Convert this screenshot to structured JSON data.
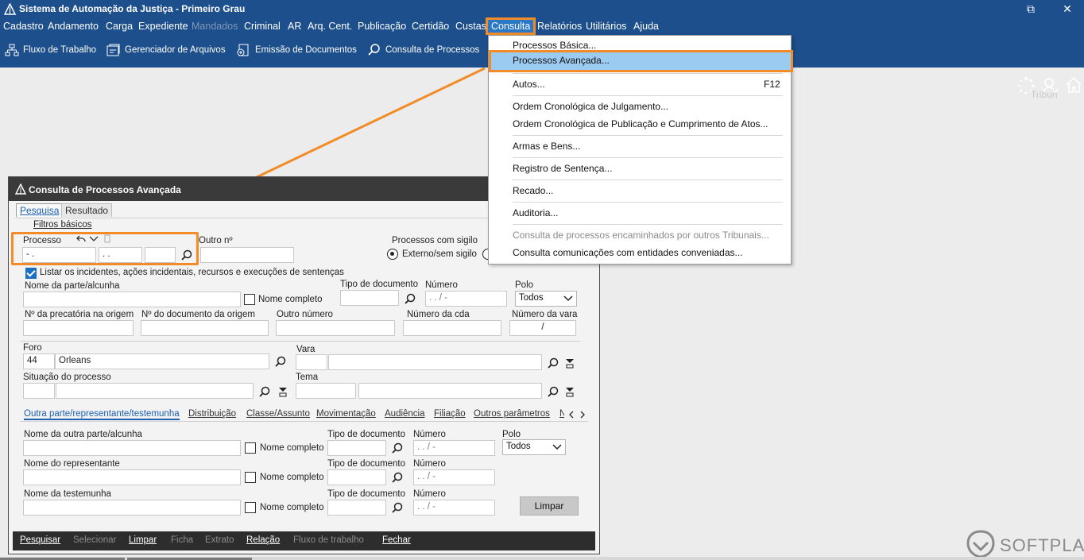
{
  "window": {
    "title": "Sistema de Automação da Justiça - Primeiro Grau",
    "restore_glyph": "⧉",
    "close_glyph": "✕"
  },
  "menu": {
    "items": [
      {
        "label": "Cadastro",
        "state": "normal"
      },
      {
        "label": "Andamento",
        "state": "normal"
      },
      {
        "label": "Carga",
        "state": "normal"
      },
      {
        "label": "Expediente",
        "state": "normal"
      },
      {
        "label": "Mandados",
        "state": "disabled"
      },
      {
        "label": "Criminal",
        "state": "normal"
      },
      {
        "label": "AR",
        "state": "normal"
      },
      {
        "label": "Arq. Cent.",
        "state": "normal"
      },
      {
        "label": "Publicação",
        "state": "normal"
      },
      {
        "label": "Certidão",
        "state": "normal"
      },
      {
        "label": "Custas",
        "state": "normal"
      },
      {
        "label": "Consulta",
        "state": "active"
      },
      {
        "label": "Relatórios",
        "state": "normal"
      },
      {
        "label": "Utilitários",
        "state": "normal"
      },
      {
        "label": "Ajuda",
        "state": "normal"
      }
    ]
  },
  "toolbar": {
    "items": [
      {
        "label": "Fluxo de Trabalho",
        "icon": "workflow-icon"
      },
      {
        "label": "Gerenciador de Arquivos",
        "icon": "file-manager-icon"
      },
      {
        "label": "Emissão de Documentos",
        "icon": "document-add-icon"
      },
      {
        "label": "Consulta de Processos",
        "icon": "search-icon"
      }
    ]
  },
  "background_watermark": "Tribun",
  "dropdown": {
    "items": [
      {
        "label": "Processos Básica...",
        "shortcut": "",
        "state": "normal"
      },
      {
        "label": "Processos Avançada...",
        "shortcut": "",
        "state": "highlighted"
      },
      {
        "label": "Autos...",
        "shortcut": "F12",
        "state": "normal"
      },
      {
        "label": "Ordem Cronológica de Julgamento...",
        "shortcut": "",
        "state": "normal"
      },
      {
        "label": "Ordem Cronológica de Publicação e Cumprimento de Atos...",
        "shortcut": "",
        "state": "normal"
      },
      {
        "label": "Armas e Bens...",
        "shortcut": "",
        "state": "normal"
      },
      {
        "label": "Registro de Sentença...",
        "shortcut": "",
        "state": "normal"
      },
      {
        "label": "Recado...",
        "shortcut": "",
        "state": "normal"
      },
      {
        "label": "Auditoria...",
        "shortcut": "",
        "state": "normal"
      },
      {
        "label": "Consulta de processos encaminhados por outros Tribunais...",
        "shortcut": "",
        "state": "disabled"
      },
      {
        "label": "Consulta comunicações com entidades conveniadas...",
        "shortcut": "",
        "state": "normal"
      }
    ]
  },
  "dialog": {
    "title": "Consulta de Processos Avançada",
    "tabs": [
      {
        "label": "Pesquisa",
        "selected": true
      },
      {
        "label": "Resultado",
        "selected": false
      }
    ],
    "filtros_label": "Filtros básicos",
    "processo": {
      "label": "Processo",
      "value1": "- .",
      "value2": ". .",
      "value3": ""
    },
    "outro_n_label": "Outro nº",
    "sigilo": {
      "label": "Processos com sigilo",
      "option": "Externo/sem sigilo"
    },
    "listar_checkbox": {
      "label": "Listar os incidentes, ações incidentais, recursos e execuções de sentenças",
      "checked": true
    },
    "nome_parte_label": "Nome da parte/alcunha",
    "nome_completo_label": "Nome completo",
    "tipo_documento_label": "Tipo de documento",
    "numero_label": "Número",
    "numero_value": ". . /   -",
    "polo_label": "Polo",
    "polo_value": "Todos",
    "precatoria_label": "Nº da precatória na origem",
    "doc_origem_label": "Nº do documento da origem",
    "outro_numero_label": "Outro número",
    "numero_cda_label": "Número da cda",
    "numero_vara_label": "Número da vara",
    "numero_vara_value": "/",
    "foro_label": "Foro",
    "foro_code": "44",
    "foro_name": "Orleans",
    "vara_label": "Vara",
    "situacao_label": "Situação do processo",
    "tema_label": "Tema",
    "subtabs": [
      {
        "label": "Outra parte/representante/testemunha",
        "selected": true
      },
      {
        "label": "Distribuição",
        "selected": false
      },
      {
        "label": "Classe/Assunto",
        "selected": false
      },
      {
        "label": "Movimentação",
        "selected": false
      },
      {
        "label": "Audiência",
        "selected": false
      },
      {
        "label": "Filiação",
        "selected": false
      },
      {
        "label": "Outros parâmetros",
        "selected": false
      },
      {
        "label": "N",
        "selected": false
      }
    ],
    "outra_parte_label": "Nome da outra parte/alcunha",
    "representante_label": "Nome do representante",
    "testemunha_label": "Nome da testemunha",
    "limpar_button": "Limpar",
    "actions": [
      {
        "label": "Pesquisar",
        "enabled": true
      },
      {
        "label": "Selecionar",
        "enabled": false
      },
      {
        "label": "Limpar",
        "enabled": true
      },
      {
        "label": "Ficha",
        "enabled": false
      },
      {
        "label": "Extrato",
        "enabled": false
      },
      {
        "label": "Relação",
        "enabled": true
      },
      {
        "label": "Fluxo de trabalho",
        "enabled": false
      },
      {
        "label": "Fechar",
        "enabled": true
      }
    ]
  },
  "brand": {
    "logo_text": "SOFTPLAN"
  },
  "colors": {
    "titlebar": "#1c4f8c",
    "highlight": "#f28c28",
    "menu_selected": "#9ccbf2",
    "dialog_title": "#3a3a3a"
  }
}
